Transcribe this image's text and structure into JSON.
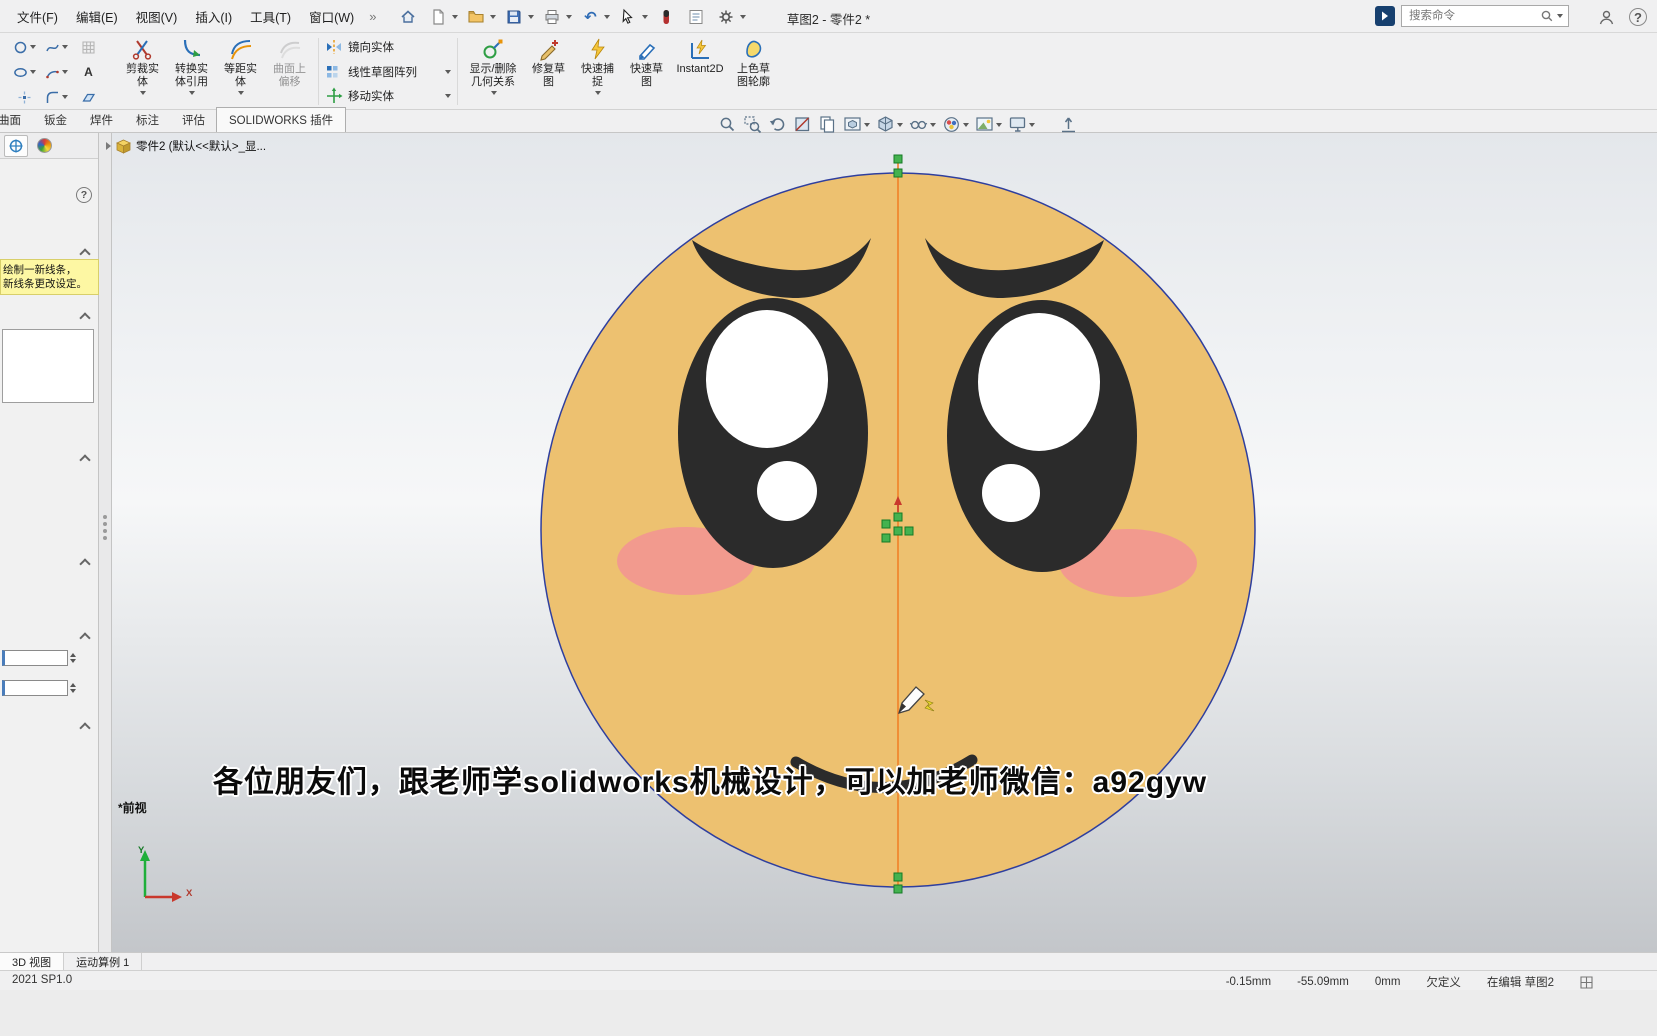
{
  "window": {
    "title": "草图2 - 零件2 *"
  },
  "menubar": {
    "menus": [
      "文件(F)",
      "编辑(E)",
      "视图(V)",
      "插入(I)",
      "工具(T)",
      "窗口(W)"
    ],
    "overflow_glyph": "»",
    "undo_glyph": "↶",
    "search_placeholder": "搜索命令",
    "help_glyph": "?"
  },
  "ribbon": {
    "group1": [
      {
        "line1": "剪裁实",
        "line2": "体"
      },
      {
        "line1": "转换实",
        "line2": "体引用"
      },
      {
        "line1": "等距实",
        "line2": "体"
      },
      {
        "line1": "曲面上",
        "line2": "偏移"
      }
    ],
    "group2": [
      {
        "label": "镜向实体"
      },
      {
        "label": "线性草图阵列"
      },
      {
        "label": "移动实体"
      }
    ],
    "group3": [
      {
        "line1": "显示/删除",
        "line2": "几何关系"
      },
      {
        "line1": "修复草",
        "line2": "图"
      },
      {
        "line1": "快速捕",
        "line2": "捉"
      },
      {
        "line1": "快速草",
        "line2": "图"
      },
      {
        "line1": "Instant2D",
        "line2": ""
      },
      {
        "line1": "上色草",
        "line2": "图轮廓"
      }
    ]
  },
  "tabs": [
    "曲面",
    "钣金",
    "焊件",
    "标注",
    "评估",
    "SOLIDWORKS 插件"
  ],
  "feature_tree": {
    "root": "零件2 (默认<<默认>_显..."
  },
  "property_panel": {
    "tip_line1": "绘制一新线条，",
    "tip_line2": "新线条更改设定。"
  },
  "sketch_glyphs": {
    "text_tool": "A"
  },
  "viewport": {
    "view_label": "*前视",
    "triad_x": "X",
    "triad_y": "Y"
  },
  "caption": "各位朋友们，跟老师学solidworks机械设计，可以加老师微信：a92gyw",
  "bottom_tabs": [
    "3D 视图",
    "运动算例 1"
  ],
  "statusbar": {
    "version": "2021 SP1.0",
    "x": "-0.15mm",
    "y": "-55.09mm",
    "z": "0mm",
    "state": "欠定义",
    "mode": "在编辑 草图2"
  },
  "colors": {
    "face_fill": "#edc170",
    "face_outline": "#2f3f9e",
    "blush": "#f29a8e",
    "feature_black": "#2b2b2b",
    "construction_line": "#f08228",
    "handle_fill": "#44b24f",
    "handle_border": "#157a26",
    "tip_bg": "#fdf7a3"
  },
  "icons": {
    "menubar": [
      "home",
      "new-document",
      "open-document",
      "save",
      "print",
      "undo",
      "select-arrow",
      "solidworks-resources",
      "task-list",
      "options-gear"
    ],
    "headsup": [
      "zoom-fit",
      "zoom-area",
      "previous-view",
      "section-view",
      "pages",
      "view-orientation",
      "display-style",
      "hide-show-items",
      "edit-appearance",
      "apply-scene",
      "view-settings",
      "normal-axis"
    ],
    "sketch_tools": [
      "circle",
      "spline",
      "grid",
      "ellipse",
      "arc",
      "text",
      "point",
      "fillet",
      "plane"
    ]
  }
}
